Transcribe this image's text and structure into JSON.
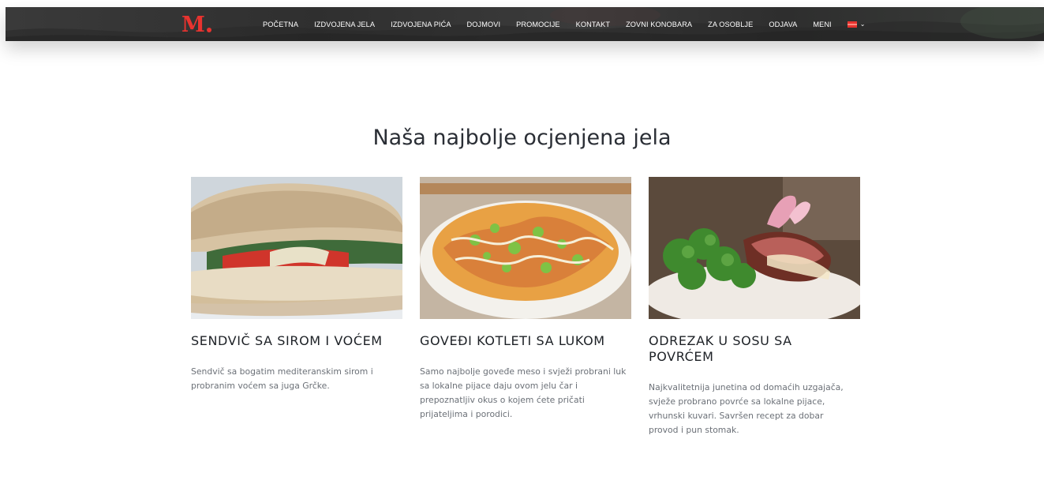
{
  "brand": {
    "logo_text": "M"
  },
  "nav": {
    "items": [
      "POČETNA",
      "IZDVOJENA JELA",
      "IZDVOJENA PIĆA",
      "DOJMOVI",
      "PROMOCIJE",
      "KONTAKT",
      "ZOVNI KONOBARA",
      "ZA OSOBLJE",
      "ODJAVA",
      "MENI"
    ],
    "language_icon": "flag-icon",
    "language_chevron": "⌄"
  },
  "section": {
    "title": "Naša najbolje ocjenjena jela"
  },
  "dishes": [
    {
      "name": "SENDVIČ SA SIROM I VOĆEM",
      "description": "Sendvič sa bogatim mediteranskim sirom i probranim voćem sa juga Grčke.",
      "image": "sandwich-image"
    },
    {
      "name": "GOVEĐI KOTLETI SA LUKOM",
      "description": "Samo najbolje goveđe meso i svježi probrani luk sa lokalne pijace daju ovom jelu čar i prepoznatljiv okus o kojem ćete pričati prijateljima i porodici.",
      "image": "noodle-bowl-image"
    },
    {
      "name": "ODREZAK U SOSU SA POVRĆEM",
      "description": "Najkvalitetnija junetina od domaćih uzgajača, svježe probrano povrće sa lokalne pijace, vrhunski kuvari. Savršen recept za dobar provod i pun stomak.",
      "image": "steak-image"
    }
  ],
  "colors": {
    "accent": "#e8332f",
    "navbar": "#333333",
    "title": "#2a2e35",
    "body_text": "#6b7077"
  }
}
